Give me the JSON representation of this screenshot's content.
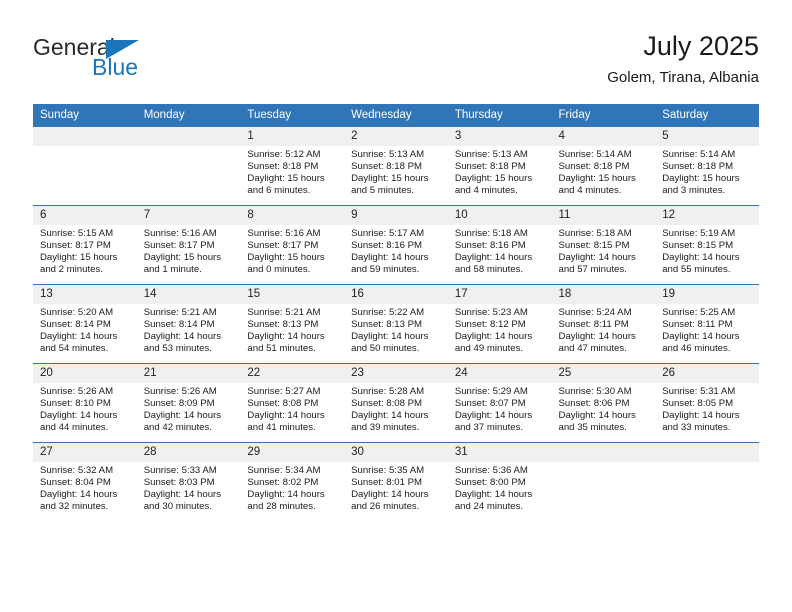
{
  "brand": {
    "name_part1": "General",
    "name_part2": "Blue",
    "accent_color": "#1b75bb"
  },
  "header": {
    "title": "July 2025",
    "location": "Golem, Tirana, Albania"
  },
  "calendar": {
    "header_bg": "#3075b8",
    "daynum_bg": "#f0f0f0",
    "weekday_headers": [
      "Sunday",
      "Monday",
      "Tuesday",
      "Wednesday",
      "Thursday",
      "Friday",
      "Saturday"
    ],
    "weeks": [
      [
        {
          "day": "",
          "sunrise": "",
          "sunset": "",
          "daylight_line1": "",
          "daylight_line2": ""
        },
        {
          "day": "",
          "sunrise": "",
          "sunset": "",
          "daylight_line1": "",
          "daylight_line2": ""
        },
        {
          "day": "1",
          "sunrise": "Sunrise: 5:12 AM",
          "sunset": "Sunset: 8:18 PM",
          "daylight_line1": "Daylight: 15 hours",
          "daylight_line2": "and 6 minutes."
        },
        {
          "day": "2",
          "sunrise": "Sunrise: 5:13 AM",
          "sunset": "Sunset: 8:18 PM",
          "daylight_line1": "Daylight: 15 hours",
          "daylight_line2": "and 5 minutes."
        },
        {
          "day": "3",
          "sunrise": "Sunrise: 5:13 AM",
          "sunset": "Sunset: 8:18 PM",
          "daylight_line1": "Daylight: 15 hours",
          "daylight_line2": "and 4 minutes."
        },
        {
          "day": "4",
          "sunrise": "Sunrise: 5:14 AM",
          "sunset": "Sunset: 8:18 PM",
          "daylight_line1": "Daylight: 15 hours",
          "daylight_line2": "and 4 minutes."
        },
        {
          "day": "5",
          "sunrise": "Sunrise: 5:14 AM",
          "sunset": "Sunset: 8:18 PM",
          "daylight_line1": "Daylight: 15 hours",
          "daylight_line2": "and 3 minutes."
        }
      ],
      [
        {
          "day": "6",
          "sunrise": "Sunrise: 5:15 AM",
          "sunset": "Sunset: 8:17 PM",
          "daylight_line1": "Daylight: 15 hours",
          "daylight_line2": "and 2 minutes."
        },
        {
          "day": "7",
          "sunrise": "Sunrise: 5:16 AM",
          "sunset": "Sunset: 8:17 PM",
          "daylight_line1": "Daylight: 15 hours",
          "daylight_line2": "and 1 minute."
        },
        {
          "day": "8",
          "sunrise": "Sunrise: 5:16 AM",
          "sunset": "Sunset: 8:17 PM",
          "daylight_line1": "Daylight: 15 hours",
          "daylight_line2": "and 0 minutes."
        },
        {
          "day": "9",
          "sunrise": "Sunrise: 5:17 AM",
          "sunset": "Sunset: 8:16 PM",
          "daylight_line1": "Daylight: 14 hours",
          "daylight_line2": "and 59 minutes."
        },
        {
          "day": "10",
          "sunrise": "Sunrise: 5:18 AM",
          "sunset": "Sunset: 8:16 PM",
          "daylight_line1": "Daylight: 14 hours",
          "daylight_line2": "and 58 minutes."
        },
        {
          "day": "11",
          "sunrise": "Sunrise: 5:18 AM",
          "sunset": "Sunset: 8:15 PM",
          "daylight_line1": "Daylight: 14 hours",
          "daylight_line2": "and 57 minutes."
        },
        {
          "day": "12",
          "sunrise": "Sunrise: 5:19 AM",
          "sunset": "Sunset: 8:15 PM",
          "daylight_line1": "Daylight: 14 hours",
          "daylight_line2": "and 55 minutes."
        }
      ],
      [
        {
          "day": "13",
          "sunrise": "Sunrise: 5:20 AM",
          "sunset": "Sunset: 8:14 PM",
          "daylight_line1": "Daylight: 14 hours",
          "daylight_line2": "and 54 minutes."
        },
        {
          "day": "14",
          "sunrise": "Sunrise: 5:21 AM",
          "sunset": "Sunset: 8:14 PM",
          "daylight_line1": "Daylight: 14 hours",
          "daylight_line2": "and 53 minutes."
        },
        {
          "day": "15",
          "sunrise": "Sunrise: 5:21 AM",
          "sunset": "Sunset: 8:13 PM",
          "daylight_line1": "Daylight: 14 hours",
          "daylight_line2": "and 51 minutes."
        },
        {
          "day": "16",
          "sunrise": "Sunrise: 5:22 AM",
          "sunset": "Sunset: 8:13 PM",
          "daylight_line1": "Daylight: 14 hours",
          "daylight_line2": "and 50 minutes."
        },
        {
          "day": "17",
          "sunrise": "Sunrise: 5:23 AM",
          "sunset": "Sunset: 8:12 PM",
          "daylight_line1": "Daylight: 14 hours",
          "daylight_line2": "and 49 minutes."
        },
        {
          "day": "18",
          "sunrise": "Sunrise: 5:24 AM",
          "sunset": "Sunset: 8:11 PM",
          "daylight_line1": "Daylight: 14 hours",
          "daylight_line2": "and 47 minutes."
        },
        {
          "day": "19",
          "sunrise": "Sunrise: 5:25 AM",
          "sunset": "Sunset: 8:11 PM",
          "daylight_line1": "Daylight: 14 hours",
          "daylight_line2": "and 46 minutes."
        }
      ],
      [
        {
          "day": "20",
          "sunrise": "Sunrise: 5:26 AM",
          "sunset": "Sunset: 8:10 PM",
          "daylight_line1": "Daylight: 14 hours",
          "daylight_line2": "and 44 minutes."
        },
        {
          "day": "21",
          "sunrise": "Sunrise: 5:26 AM",
          "sunset": "Sunset: 8:09 PM",
          "daylight_line1": "Daylight: 14 hours",
          "daylight_line2": "and 42 minutes."
        },
        {
          "day": "22",
          "sunrise": "Sunrise: 5:27 AM",
          "sunset": "Sunset: 8:08 PM",
          "daylight_line1": "Daylight: 14 hours",
          "daylight_line2": "and 41 minutes."
        },
        {
          "day": "23",
          "sunrise": "Sunrise: 5:28 AM",
          "sunset": "Sunset: 8:08 PM",
          "daylight_line1": "Daylight: 14 hours",
          "daylight_line2": "and 39 minutes."
        },
        {
          "day": "24",
          "sunrise": "Sunrise: 5:29 AM",
          "sunset": "Sunset: 8:07 PM",
          "daylight_line1": "Daylight: 14 hours",
          "daylight_line2": "and 37 minutes."
        },
        {
          "day": "25",
          "sunrise": "Sunrise: 5:30 AM",
          "sunset": "Sunset: 8:06 PM",
          "daylight_line1": "Daylight: 14 hours",
          "daylight_line2": "and 35 minutes."
        },
        {
          "day": "26",
          "sunrise": "Sunrise: 5:31 AM",
          "sunset": "Sunset: 8:05 PM",
          "daylight_line1": "Daylight: 14 hours",
          "daylight_line2": "and 33 minutes."
        }
      ],
      [
        {
          "day": "27",
          "sunrise": "Sunrise: 5:32 AM",
          "sunset": "Sunset: 8:04 PM",
          "daylight_line1": "Daylight: 14 hours",
          "daylight_line2": "and 32 minutes."
        },
        {
          "day": "28",
          "sunrise": "Sunrise: 5:33 AM",
          "sunset": "Sunset: 8:03 PM",
          "daylight_line1": "Daylight: 14 hours",
          "daylight_line2": "and 30 minutes."
        },
        {
          "day": "29",
          "sunrise": "Sunrise: 5:34 AM",
          "sunset": "Sunset: 8:02 PM",
          "daylight_line1": "Daylight: 14 hours",
          "daylight_line2": "and 28 minutes."
        },
        {
          "day": "30",
          "sunrise": "Sunrise: 5:35 AM",
          "sunset": "Sunset: 8:01 PM",
          "daylight_line1": "Daylight: 14 hours",
          "daylight_line2": "and 26 minutes."
        },
        {
          "day": "31",
          "sunrise": "Sunrise: 5:36 AM",
          "sunset": "Sunset: 8:00 PM",
          "daylight_line1": "Daylight: 14 hours",
          "daylight_line2": "and 24 minutes."
        },
        {
          "day": "",
          "sunrise": "",
          "sunset": "",
          "daylight_line1": "",
          "daylight_line2": ""
        },
        {
          "day": "",
          "sunrise": "",
          "sunset": "",
          "daylight_line1": "",
          "daylight_line2": ""
        }
      ]
    ]
  }
}
